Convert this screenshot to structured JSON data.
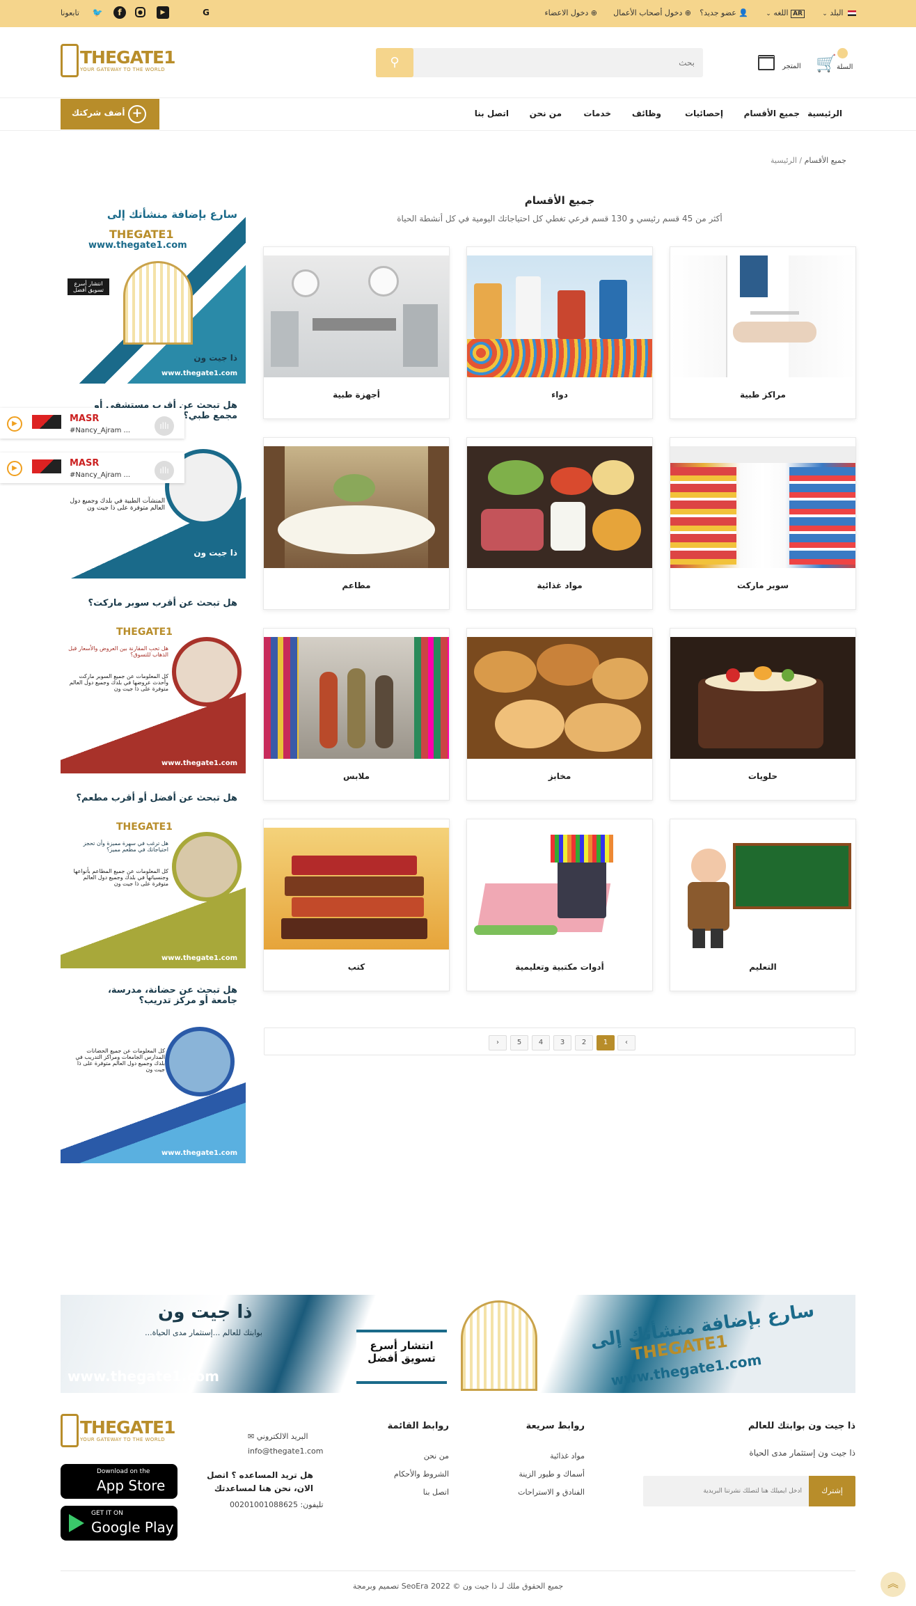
{
  "topbar": {
    "country_label": "البلد",
    "language_label": "اللغه",
    "language_code": "AR",
    "new_member": "عضو جديد؟",
    "business_login": "دخول أصحاب الأعمال",
    "member_login": "دخول الاعضاء",
    "follow_us": "تابعونا"
  },
  "header": {
    "logo_text": "THEGATE1",
    "logo_tagline": "YOUR GATEWAY TO THE WORLD",
    "search_placeholder": "بحث",
    "store_label": "المتجر",
    "cart_label": "السلة",
    "cart_count": ""
  },
  "nav": {
    "items": [
      "الرئيسية",
      "جميع الأقسام",
      "إحصائيات",
      "وظائف",
      "خدمات",
      "من نحن",
      "اتصل بنا"
    ],
    "add_company": "أضف شركتك"
  },
  "breadcrumb": {
    "home": "الرئيسية",
    "sep": "/",
    "current": "جميع الأقسام"
  },
  "main": {
    "title": "جميع الأقسام",
    "subtitle": "أكثر من 45 قسم رئيسي و 130 قسم فرعي تغطي كل احتياجاتك اليومية في كل أنشطة الحياة",
    "categories": [
      {
        "label": "مراكز طبية",
        "icon": "doctor-image"
      },
      {
        "label": "دواء",
        "icon": "medicine-image"
      },
      {
        "label": "أجهزة طبية",
        "icon": "medical-devices-image"
      },
      {
        "label": "سوبر ماركت",
        "icon": "supermarket-image"
      },
      {
        "label": "مواد غذائية",
        "icon": "food-image"
      },
      {
        "label": "مطاعم",
        "icon": "restaurant-image"
      },
      {
        "label": "حلويات",
        "icon": "cake-image"
      },
      {
        "label": "مخابز",
        "icon": "bread-image"
      },
      {
        "label": "ملابس",
        "icon": "clothes-image"
      },
      {
        "label": "التعليم",
        "icon": "teacher-image"
      },
      {
        "label": "أدوات مكتبية وتعليمية",
        "icon": "stationery-image"
      },
      {
        "label": "كتب",
        "icon": "books-image"
      }
    ],
    "pagination": {
      "prev": "‹",
      "pages": [
        "1",
        "2",
        "3",
        "4",
        "5"
      ],
      "next": "›",
      "current": "1"
    }
  },
  "ads": [
    {
      "headline": "سارع بإضافة منشأتك إلى",
      "url": "www.thegate1.com",
      "brand": "THEGATE1",
      "slogan": "ذا جيت ون",
      "sub": "بوابتك للعالم ...إستثمار مدى الحياة",
      "badge": "انتشار أسرع تسويق أفضل"
    },
    {
      "headline": "هل تبحث عن أقرب مستشفى أو مجمع طبي؟",
      "url": "www.thegate1.com",
      "brand": "THEGATE1",
      "slogan": "ذا جيت ون",
      "sub": "المنشآت الطبية في بلدك وجميع دول العالم متوفرة على ذا جيت ون",
      "badge": ""
    },
    {
      "headline": "هل تبحث عن أقرب سوبر ماركت؟",
      "url": "www.thegate1.com",
      "brand": "THEGATE1",
      "slogan": "ذا جيت ون",
      "sub": "كل المعلومات عن جميع السوبر ماركت وأحدث عروضها في بلدك وجميع دول العالم متوفرة على ذا جيت ون",
      "badge": "هل تحب المقارنة بين العروض والأسعار قبل الذهاب للتسوق؟"
    },
    {
      "headline": "هل تبحث عن أفضل أو أقرب مطعم؟",
      "url": "www.thegate1.com",
      "brand": "THEGATE1",
      "slogan": "ذا جيت ون",
      "sub": "كل المعلومات عن جميع المطاعم بأنواعها وجنسياتها في بلدك وجميع دول العالم متوفرة على ذا جيت ون",
      "badge": "هل ترغب في سهرة مميزة وأن تحجز احتياجاتك في مطعم مميز؟"
    },
    {
      "headline": "هل تبحث عن حضانة، مدرسة، جامعة أو مركز تدريب؟",
      "url": "www.thegate1.com",
      "brand": "THEGATE1",
      "slogan": "ذا جيت ون",
      "sub": "كل المعلومات عن جميع الحضانات المدارس الجامعات ومراكز التدريب في بلدك وجميع دول العالم متوفرة على ذا جيت ون",
      "badge": ""
    }
  ],
  "radio": [
    {
      "station": "MASR",
      "track": "#Nancy_Ajram ..."
    },
    {
      "station": "MASR",
      "track": "#Nancy_Ajram ..."
    }
  ],
  "banner": {
    "headline": "سارع بإضافة منشأتك إلى",
    "brand": "THEGATE1",
    "url": "www.thegate1.com",
    "slogan": "ذا جيت ون",
    "sub": "...بوابتك للعالم ...إستثمار مدى الحياة",
    "badge_line1": "انتشار أسرع",
    "badge_line2": "تسويق أفضل"
  },
  "footer": {
    "about_title": "ذا جيت ون بوابتك للعالم",
    "about_text": "ذا جيت ون إستثمار مدى الحياة",
    "newsletter_placeholder": "ادخل ايميلك هنا لتصلك نشرتنا البريدية",
    "subscribe": "إشترك",
    "quick_links_title": "روابط سريعة",
    "quick_links": [
      "مواد غذائية",
      "أسماك و طيور الزينة",
      "الفنادق و الاستراحات"
    ],
    "menu_links_title": "روابط القائمة",
    "menu_links": [
      "من نحن",
      "الشروط والأحكام",
      "اتصل بنا"
    ],
    "email_label": "البريد الالكتروني",
    "email": "info@thegate1.com",
    "help_text": "هل تريد المساعده ؟ اتصل الان، نحن هنا لمساعدتك",
    "phone": "تليفون: 00201001088625",
    "appstore_small": "Download on the",
    "appstore_big": "App Store",
    "gplay_small": "GET IT ON",
    "gplay_big": "Google Play",
    "copyright": "تصميم وبرمجة SeoEra جميع الحقوق ملك لـ ذا جيت ون © 2022"
  },
  "colors": {
    "brand": "#b88d2a",
    "topbar": "#f5d58c"
  }
}
